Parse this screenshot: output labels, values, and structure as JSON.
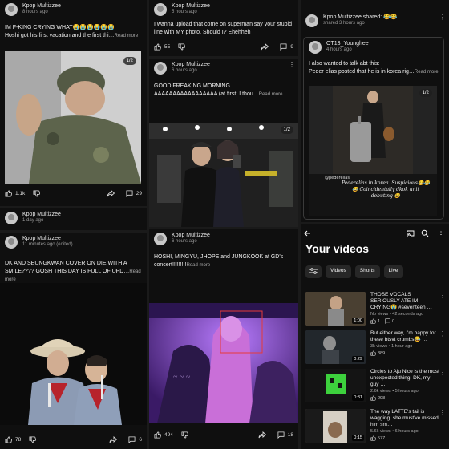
{
  "posts": {
    "p1": {
      "author": "Kpop Multizzee",
      "time": "8 hours ago",
      "text": "IM F-KING CRYING WHAT😭😭😭😭😭😭",
      "text2": "Hoshi got his first vacation and the first thi…",
      "more": "Read more",
      "badge": "1/2",
      "likes": "1.1k",
      "comments": "29"
    },
    "p2": {
      "author": "Kpop Multizzee",
      "time": "1 day ago"
    },
    "p3": {
      "author": "Kpop Multizzee",
      "time": "11 minutes ago (edited)",
      "text": "DK AND SEUNGKWAN COVER ON DIE WITH A SMILE???? GOSH THIS DAY IS FULL OF UPD…",
      "more": "Read more",
      "likes": "78",
      "comments": "6"
    },
    "p4": {
      "author": "Kpop Multizzee",
      "time": "5 hours ago",
      "text": "I wanna upload that come on superman say your stupid line with MY photo. Should I? Ehehheh",
      "likes": "55",
      "comments": "9"
    },
    "p5": {
      "author": "Kpop Multizzee",
      "time": "6 hours ago",
      "text": "GOOD FREAKING MORNING. AAAAAAAAAAAAAAAAA (at first, I thou…",
      "more": "Read more",
      "badge": "1/2"
    },
    "p6": {
      "author": "Kpop Multizzee",
      "time": "6 hours ago",
      "text": "HOSHI, MINGYU, JHOPE and JUNGKOOK at GD's concert!!!!!!!!!",
      "more": "Read more",
      "likes": "494",
      "comments": "18"
    },
    "p7": {
      "author": "Kpop Multizzee shared: 😂😂",
      "time": "shared 3 hours ago",
      "inner_author": "OT13_Younghee",
      "inner_time": "4 hours ago",
      "inner_text": "I also wanted to talk abt this:",
      "inner_text2": "Peder elias posted that he is in korea rig…",
      "more": "Read more",
      "badge": "1/2",
      "caption_user": "@pederelias",
      "caption": "Pederelias in korea. Suspicious😂😂😂 Coincidentally dkok unit debuting 😂"
    }
  },
  "yourvideos": {
    "title": "Your videos",
    "chips": [
      "Videos",
      "Shorts",
      "Live"
    ],
    "videos": [
      {
        "title": "THOSE VOCALS SERIOUSLY ATE IM CRYING😭 #seventeen …",
        "meta": "No views • 42 seconds ago",
        "likes": "1",
        "comments": "0",
        "duration": "1:00",
        "color": "#5a4e3c"
      },
      {
        "title": "But either way, I'm happy for these btsvt crumbs😂 …",
        "meta": "3k views • 1 hour ago",
        "likes": "389",
        "comments": "",
        "duration": "0:29",
        "color": "#2b3035"
      },
      {
        "title": "Circles to Aju Nice is the most unexpected thing. DK, my guy …",
        "meta": "2.6k views • 5 hours ago",
        "likes": "298",
        "comments": "",
        "duration": "0:31",
        "color": "#2c3a22"
      },
      {
        "title": "The way LATTE's tail is wagging. she must've missed him sm…",
        "meta": "5.6k views • 6 hours ago",
        "likes": "577",
        "comments": "",
        "duration": "0:15",
        "color": "#6a5a4a"
      }
    ]
  },
  "colors": {
    "panel_bg": "#0f0f0f",
    "accent_green": "#3dd13d",
    "concert_purple": "#8a4fd6"
  }
}
